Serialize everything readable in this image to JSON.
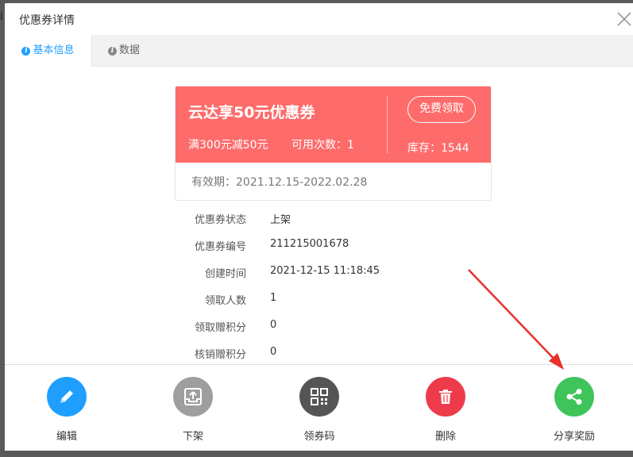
{
  "background": {
    "text": "i"
  },
  "dialog": {
    "title": "优惠券详情",
    "tabs": [
      {
        "label": "基本信息",
        "active": true
      },
      {
        "label": "数据",
        "active": false
      }
    ]
  },
  "coupon": {
    "name": "云达享50元优惠券",
    "condition": "满300元减50元",
    "uses": "可用次数：1",
    "claim_label": "免费领取",
    "stock": "库存：1544",
    "validity": "有效期：2021.12.15-2022.02.28"
  },
  "details": [
    {
      "label": "优惠券状态",
      "value": "上架"
    },
    {
      "label": "优惠券编号",
      "value": "211215001678"
    },
    {
      "label": "创建时间",
      "value": "2021-12-15 11:18:45"
    },
    {
      "label": "领取人数",
      "value": "1"
    },
    {
      "label": "领取赠积分",
      "value": "0"
    },
    {
      "label": "核销赠积分",
      "value": "0"
    }
  ],
  "actions": [
    {
      "label": "编辑",
      "icon": "pencil-icon",
      "color": "#1e9fff"
    },
    {
      "label": "下架",
      "icon": "tray-upload-icon",
      "color": "#9e9e9e"
    },
    {
      "label": "领券码",
      "icon": "qr-code-icon",
      "color": "#555555"
    },
    {
      "label": "删除",
      "icon": "trash-icon",
      "color": "#ee3b4b"
    },
    {
      "label": "分享奖励",
      "icon": "share-icon",
      "color": "#3ec45a"
    }
  ],
  "colors": {
    "coupon_head": "#fe6b6b",
    "tab_active": "#1e9fff",
    "annotation_arrow": "#e8302c"
  }
}
